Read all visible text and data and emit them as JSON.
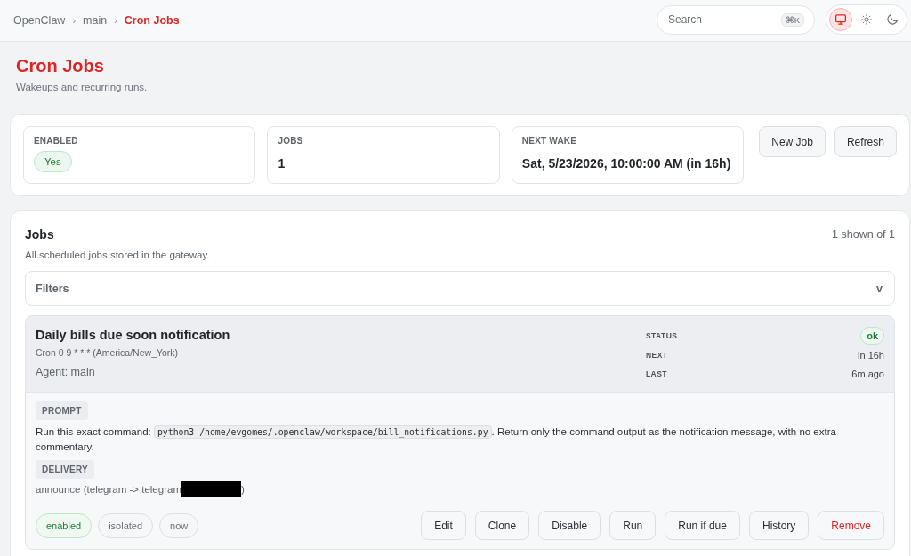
{
  "breadcrumb": {
    "separator": "›",
    "items": [
      {
        "label": "OpenClaw",
        "current": false
      },
      {
        "label": "main",
        "current": false
      },
      {
        "label": "Cron Jobs",
        "current": true
      }
    ]
  },
  "search": {
    "placeholder": "Search",
    "shortcut": "⌘K"
  },
  "theme_options": [
    {
      "kind": "system",
      "selected": true
    },
    {
      "kind": "light",
      "selected": false
    },
    {
      "kind": "dark",
      "selected": false
    }
  ],
  "page": {
    "title": "Cron Jobs",
    "subtitle": "Wakeups and recurring runs."
  },
  "stats": [
    {
      "label": "ENABLED",
      "kind": "badge",
      "value": "Yes"
    },
    {
      "label": "JOBS",
      "kind": "text",
      "value": "1"
    },
    {
      "label": "NEXT WAKE",
      "kind": "text",
      "value": "Sat, 5/23/2026, 10:00:00 AM (in 16h)"
    }
  ],
  "actions": [
    "New Job",
    "Refresh"
  ],
  "jobs_panel": {
    "title": "Jobs",
    "count": "1 shown of 1",
    "subtitle": "All scheduled jobs stored in the gateway.",
    "filters": {
      "label": "Filters",
      "toggle": "v"
    }
  },
  "jobs": [
    {
      "title": "Daily bills due soon notification",
      "schedule": "Cron 0 9 * * * (America/New_York)",
      "agent": "Agent: main",
      "meta": [
        {
          "label": "STATUS",
          "kind": "badge",
          "value": "ok"
        },
        {
          "label": "NEXT",
          "kind": "text",
          "value": "in 16h"
        },
        {
          "label": "LAST",
          "kind": "text",
          "value": "6m ago"
        }
      ],
      "prompt": {
        "label": "PROMPT",
        "before": "Run this exact command:",
        "code": "python3 /home/evgomes/.openclaw/workspace/bill_notifications.py",
        "after": ". Return only the command output as the notification message, with no extra commentary."
      },
      "delivery": {
        "label": "DELIVERY",
        "text": "announce (telegram -> telegram",
        "redacted": true,
        "suffix": ")"
      },
      "tags": [
        {
          "label": "enabled",
          "kind": "positive"
        },
        {
          "label": "isolated",
          "kind": "neutral"
        },
        {
          "label": "now",
          "kind": "neutral"
        }
      ],
      "buttons": [
        {
          "label": "Edit",
          "kind": "default"
        },
        {
          "label": "Clone",
          "kind": "default"
        },
        {
          "label": "Disable",
          "kind": "default"
        },
        {
          "label": "Run",
          "kind": "default"
        },
        {
          "label": "Run if due",
          "kind": "default"
        },
        {
          "label": "History",
          "kind": "default"
        },
        {
          "label": "Remove",
          "kind": "danger"
        }
      ]
    }
  ]
}
